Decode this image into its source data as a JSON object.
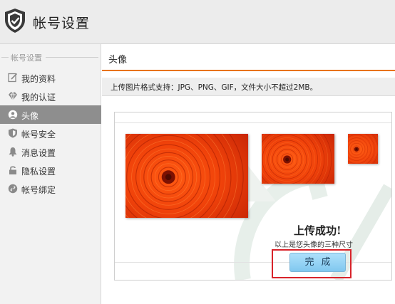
{
  "header": {
    "title": "帐号设置",
    "logo_icon": "shield-check-icon"
  },
  "sidebar": {
    "section_label": "帐号设置",
    "items": [
      {
        "label": "我的资料",
        "icon": "edit-icon",
        "active": false
      },
      {
        "label": "我的认证",
        "icon": "diamond-icon",
        "active": false
      },
      {
        "label": "头像",
        "icon": "avatar-icon",
        "active": true
      },
      {
        "label": "帐号安全",
        "icon": "shield-icon",
        "active": false
      },
      {
        "label": "消息设置",
        "icon": "bell-icon",
        "active": false
      },
      {
        "label": "隐私设置",
        "icon": "lock-icon",
        "active": false
      },
      {
        "label": "帐号绑定",
        "icon": "link-icon",
        "active": false
      }
    ]
  },
  "main": {
    "title": "头像",
    "notice": "上传图片格式支持：JPG、PNG、GIF，文件大小不超过2MB。",
    "success_title": "上传成功!",
    "success_sub": "以上是您头像的三种尺寸",
    "done_label": "完成"
  },
  "colors": {
    "accent": "#e8731c",
    "active_bg": "#8e8e8e",
    "highlight": "#d8232a",
    "button": "#9fd8f7"
  }
}
